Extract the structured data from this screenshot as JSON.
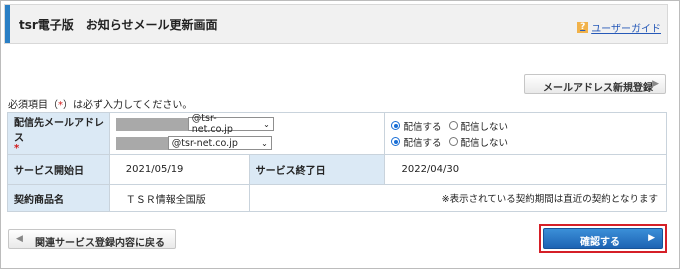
{
  "header": {
    "title": "tsr電子版　お知らせメール更新画面",
    "guide_label": "ユーザーガイド",
    "guide_icon": "help-question-icon",
    "accent_color": "#2a7fc5"
  },
  "actions": {
    "register_label": "メールアドレス新規登録",
    "back_label": "関連サービス登録内容に戻る",
    "confirm_label": "確認する"
  },
  "required_note": {
    "prefix": "必須項目（",
    "star": "*",
    "suffix": "）は必ず入力してください。"
  },
  "form": {
    "email": {
      "label": "配信先メールアドレス",
      "required_mark": "*",
      "rows": [
        {
          "domain_value": "@tsr-net.co.jp",
          "delivery_on_label": "配信する",
          "delivery_off_label": "配信しない",
          "selected": "on"
        },
        {
          "domain_value": "@tsr-net.co.jp",
          "delivery_on_label": "配信する",
          "delivery_off_label": "配信しない",
          "selected": "on"
        }
      ]
    },
    "service_start": {
      "label": "サービス開始日",
      "value": "2021/05/19"
    },
    "service_end": {
      "label": "サービス終了日",
      "value": "2022/04/30"
    },
    "product": {
      "label": "契約商品名",
      "value": "ＴＳＲ情報全国版",
      "note": "※表示されている契約期間は直近の契約となります"
    }
  },
  "colors": {
    "header_cell_bg": "#dbe9f5",
    "confirm_button": "#1d63b3",
    "highlight_outline": "#d51f27",
    "required_star": "#d21a1a"
  }
}
